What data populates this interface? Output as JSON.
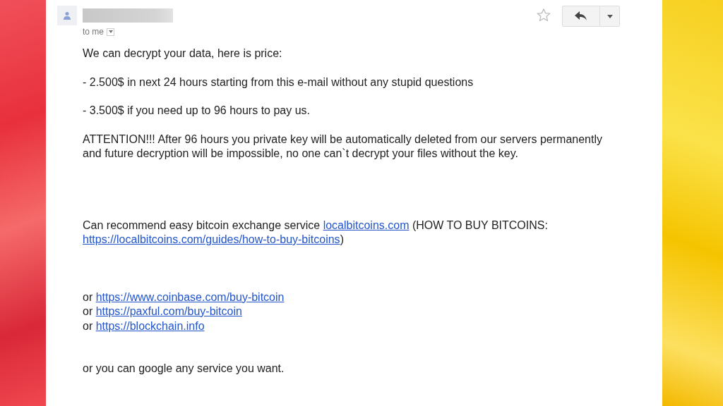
{
  "header": {
    "recipient_label": "to me",
    "starred": false
  },
  "body": [
    {
      "parts": [
        {
          "text": "We can decrypt your data, here is price:"
        }
      ]
    },
    {
      "parts": [
        {
          "text": "- 2.500$ in next 24 hours starting from this e-mail without any stupid questions"
        }
      ]
    },
    {
      "parts": [
        {
          "text": "- 3.500$ if you need up to 96 hours to pay us."
        }
      ]
    },
    {
      "parts": [
        {
          "text": "ATTENTION!!! After 96 hours you private key will be automatically deleted from our servers permanently and future decryption will be impossible, no one can`t decrypt your files without the key."
        }
      ]
    },
    {
      "parts": [
        {
          "text": "Can recommend easy bitcoin exchange service "
        },
        {
          "link": "localbitcoins.com"
        },
        {
          "text": " (HOW TO BUY BITCOINS: "
        },
        {
          "link": "https://localbitcoins.com/guides/how-to-buy-bitcoins"
        },
        {
          "text": ")"
        }
      ]
    },
    {
      "parts": [
        {
          "text": "or "
        },
        {
          "link": "https://www.coinbase.com/buy-bitcoin"
        }
      ]
    },
    {
      "parts": [
        {
          "text": "or "
        },
        {
          "link": "https://paxful.com/buy-bitcoin"
        }
      ]
    },
    {
      "parts": [
        {
          "text": "or "
        },
        {
          "link": "https://blockchain.info"
        }
      ]
    },
    {
      "parts": [
        {
          "text": "or you can google any service you want."
        }
      ]
    }
  ]
}
